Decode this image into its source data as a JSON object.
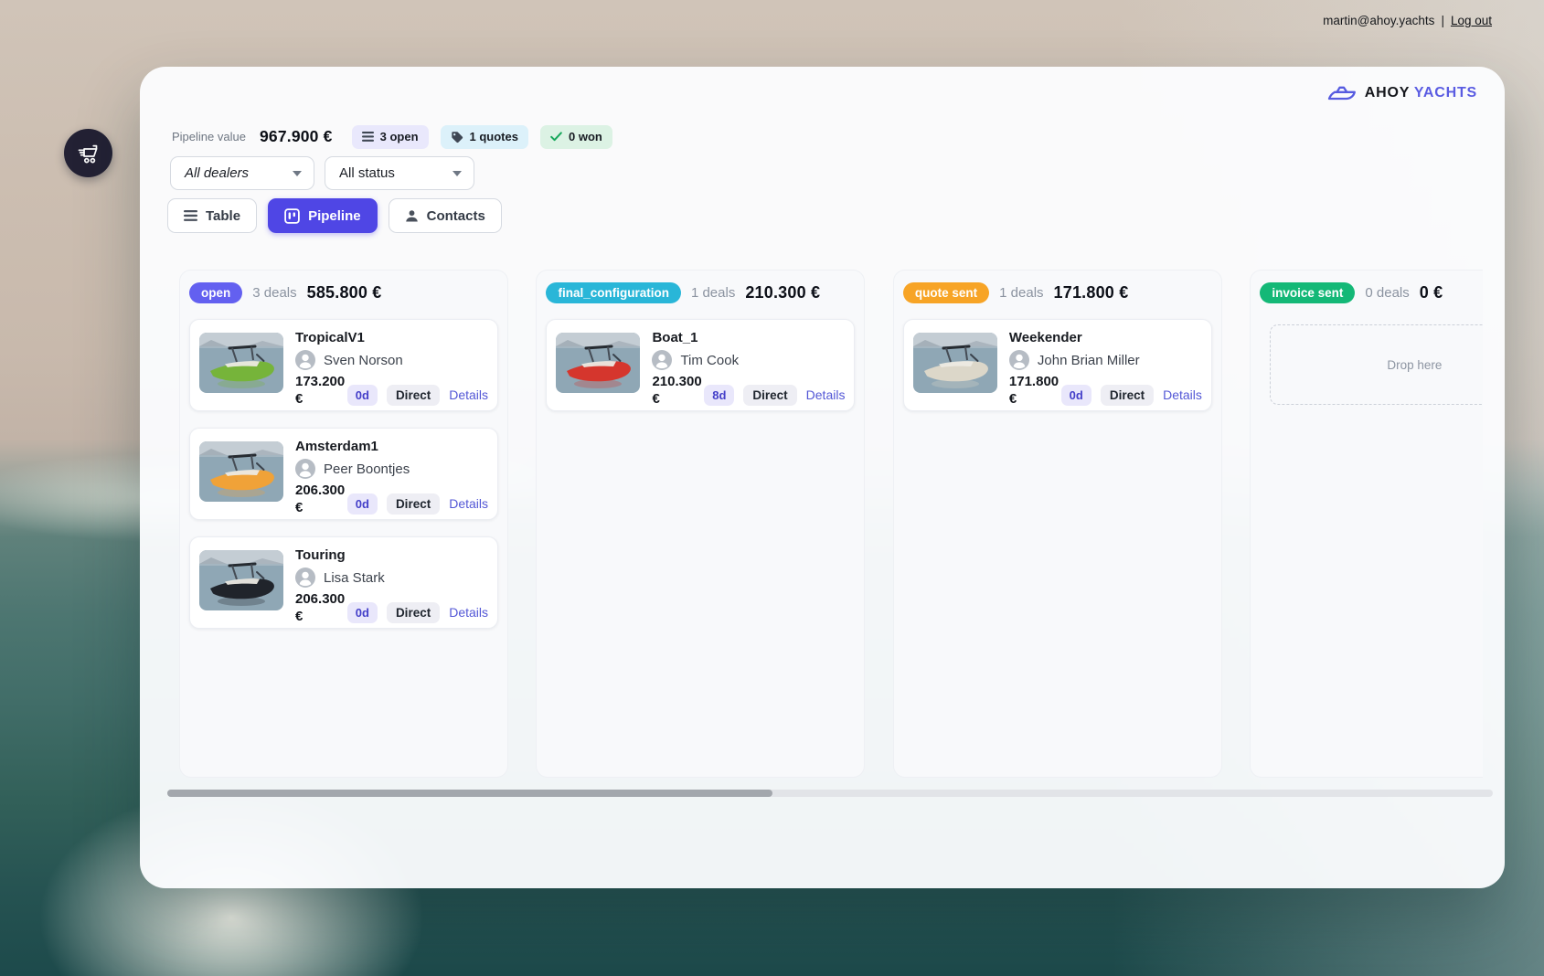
{
  "account": {
    "email": "martin@ahoy.yachts",
    "separator": "|",
    "logout_label": "Log out"
  },
  "brand": {
    "name_primary": "AHOY",
    "name_secondary": "YACHTS",
    "accent": "#5a5ce2"
  },
  "stats": {
    "label": "Pipeline value",
    "value": "967.900 €",
    "badges": [
      {
        "icon": "list-icon",
        "label": "3 open",
        "bg": "#e9e8fc"
      },
      {
        "icon": "tag-icon",
        "label": "1 quotes",
        "bg": "#dcf1fa"
      },
      {
        "icon": "check-icon",
        "label": "0 won",
        "bg": "#dcf2e4"
      }
    ]
  },
  "filters": {
    "dealers": {
      "value": "All dealers"
    },
    "status": {
      "value": "All status"
    }
  },
  "view_tabs": [
    {
      "label": "Table",
      "icon": "list-icon",
      "active": false
    },
    {
      "label": "Pipeline",
      "icon": "kanban-icon",
      "active": true
    },
    {
      "label": "Contacts",
      "icon": "person-icon",
      "active": false
    }
  ],
  "board": {
    "columns": [
      {
        "stage": "open",
        "stage_color": "#6360f0",
        "deals_label": "3 deals",
        "total": "585.800 €",
        "cards": [
          {
            "title": "TropicalV1",
            "contact": "Sven Norson",
            "price": "173.200 €",
            "age": "0d",
            "channel": "Direct",
            "details_label": "Details",
            "boat_color": "#76b43a"
          },
          {
            "title": "Amsterdam1",
            "contact": "Peer Boontjes",
            "price": "206.300 €",
            "age": "0d",
            "channel": "Direct",
            "details_label": "Details",
            "boat_color": "#f0a238"
          },
          {
            "title": "Touring",
            "contact": "Lisa Stark",
            "price": "206.300 €",
            "age": "0d",
            "channel": "Direct",
            "details_label": "Details",
            "boat_color": "#20242b"
          }
        ]
      },
      {
        "stage": "final_configuration",
        "stage_color": "#29b6d8",
        "deals_label": "1 deals",
        "total": "210.300 €",
        "cards": [
          {
            "title": "Boat_1",
            "contact": "Tim Cook",
            "price": "210.300 €",
            "age": "8d",
            "channel": "Direct",
            "details_label": "Details",
            "boat_color": "#d5362d"
          }
        ]
      },
      {
        "stage": "quote sent",
        "stage_color": "#f7a426",
        "deals_label": "1 deals",
        "total": "171.800 €",
        "cards": [
          {
            "title": "Weekender",
            "contact": "John Brian Miller",
            "price": "171.800 €",
            "age": "0d",
            "channel": "Direct",
            "details_label": "Details",
            "boat_color": "#dcd7c9"
          }
        ]
      },
      {
        "stage": "invoice sent",
        "stage_color": "#14b877",
        "deals_label": "0 deals",
        "total": "0 €",
        "cards": [],
        "empty_label": "Drop here"
      }
    ]
  }
}
